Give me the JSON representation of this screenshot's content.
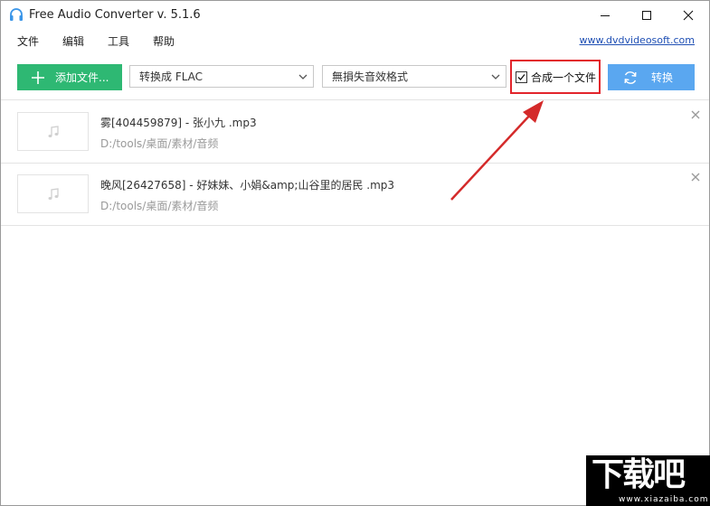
{
  "window": {
    "title": "Free Audio Converter v. 5.1.6"
  },
  "menu": {
    "items": [
      "文件",
      "编辑",
      "工具",
      "帮助"
    ],
    "site_link": "www.dvdvideosoft.com"
  },
  "toolbar": {
    "add_files_label": "添加文件...",
    "format_select": "转换成 FLAC",
    "quality_select": "無損失音效格式",
    "merge_label": "合成一个文件",
    "merge_checked": true,
    "convert_label": "转换"
  },
  "files": [
    {
      "name": "雾[404459879] - 张小九 .mp3",
      "path": "D:/tools/桌面/素材/音频"
    },
    {
      "name": "晚风[26427658] - 好妹妹、小娟&amp;山谷里的居民 .mp3",
      "path": "D:/tools/桌面/素材/音频"
    }
  ],
  "watermark": {
    "logo_text": "下载吧",
    "url": "www.xiazaiba.com"
  },
  "colors": {
    "add_button": "#2eb873",
    "convert_button": "#5aa7f0",
    "highlight": "#e2242b",
    "link": "#1f4fb4"
  },
  "icons": {
    "app": "headphones-icon",
    "add": "plus-icon",
    "convert": "sync-icon",
    "thumbnail": "music-note-icon",
    "remove": "close-icon"
  }
}
